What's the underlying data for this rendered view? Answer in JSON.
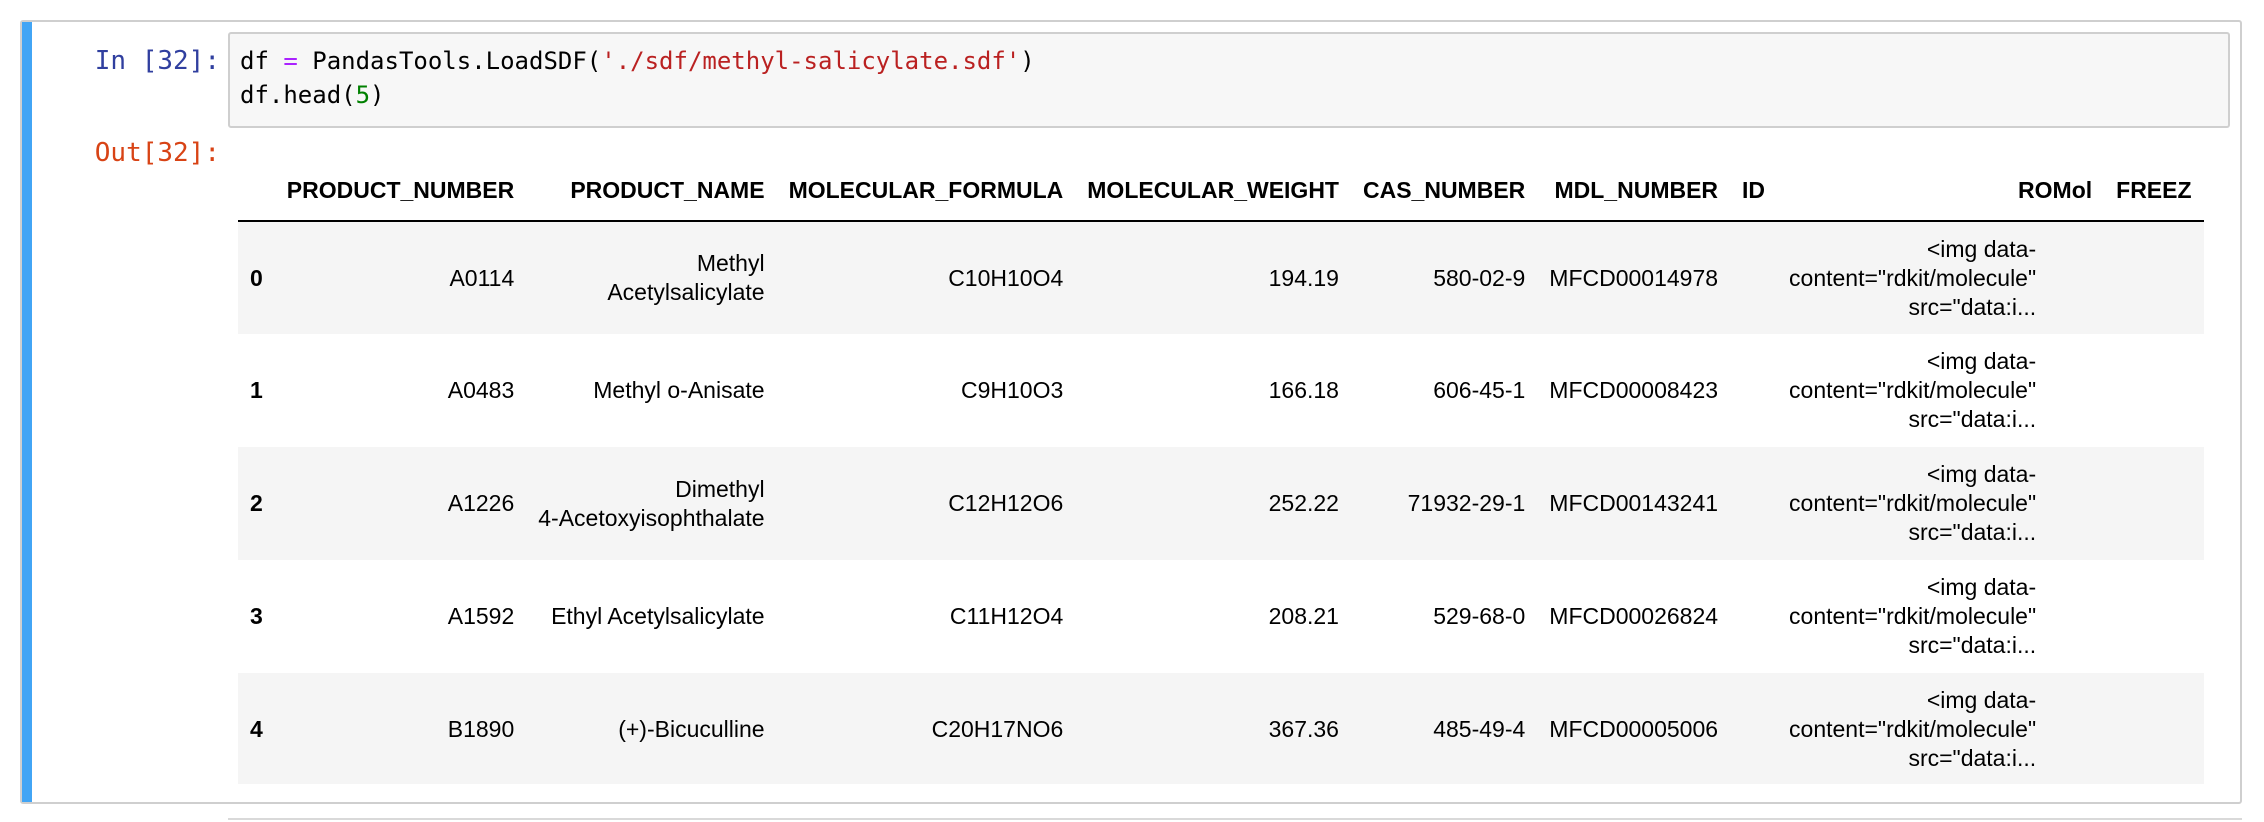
{
  "cell": {
    "in_prompt": "In [32]:",
    "out_prompt": "Out[32]:",
    "code": {
      "line1": [
        {
          "t": "df ",
          "c": ""
        },
        {
          "t": "=",
          "c": "op"
        },
        {
          "t": " PandasTools.LoadSDF(",
          "c": ""
        },
        {
          "t": "'./sdf/methyl-salicylate.sdf'",
          "c": "str"
        },
        {
          "t": ")",
          "c": ""
        }
      ],
      "line2": [
        {
          "t": "df.head(",
          "c": ""
        },
        {
          "t": "5",
          "c": "num"
        },
        {
          "t": ")",
          "c": ""
        }
      ]
    }
  },
  "table": {
    "columns": [
      "",
      "PRODUCT_NUMBER",
      "PRODUCT_NAME",
      "MOLECULAR_FORMULA",
      "MOLECULAR_WEIGHT",
      "CAS_NUMBER",
      "MDL_NUMBER",
      "ID",
      "ROMol",
      "FREEZ"
    ],
    "rows": [
      {
        "index": "0",
        "product_number": "A0114",
        "product_name": [
          "Methyl",
          "Acetylsalicylate"
        ],
        "formula": "C10H10O4",
        "weight": "194.19",
        "cas": "580-02-9",
        "mdl": "MFCD00014978",
        "id": "",
        "romol": [
          "<img data-",
          "content=\"rdkit/molecule\"",
          "src=\"data:i..."
        ]
      },
      {
        "index": "1",
        "product_number": "A0483",
        "product_name": [
          "Methyl o-Anisate"
        ],
        "formula": "C9H10O3",
        "weight": "166.18",
        "cas": "606-45-1",
        "mdl": "MFCD00008423",
        "id": "",
        "romol": [
          "<img data-",
          "content=\"rdkit/molecule\"",
          "src=\"data:i..."
        ]
      },
      {
        "index": "2",
        "product_number": "A1226",
        "product_name": [
          "Dimethyl",
          "4-Acetoxyisophthalate"
        ],
        "formula": "C12H12O6",
        "weight": "252.22",
        "cas": "71932-29-1",
        "mdl": "MFCD00143241",
        "id": "",
        "romol": [
          "<img data-",
          "content=\"rdkit/molecule\"",
          "src=\"data:i..."
        ]
      },
      {
        "index": "3",
        "product_number": "A1592",
        "product_name": [
          "Ethyl Acetylsalicylate"
        ],
        "formula": "C11H12O4",
        "weight": "208.21",
        "cas": "529-68-0",
        "mdl": "MFCD00026824",
        "id": "",
        "romol": [
          "<img data-",
          "content=\"rdkit/molecule\"",
          "src=\"data:i..."
        ]
      },
      {
        "index": "4",
        "product_number": "B1890",
        "product_name": [
          "(+)-Bicuculline"
        ],
        "formula": "C20H17NO6",
        "weight": "367.36",
        "cas": "485-49-4",
        "mdl": "MFCD00005006",
        "id": "",
        "romol": [
          "<img data-",
          "content=\"rdkit/molecule\"",
          "src=\"data:i..."
        ]
      }
    ]
  },
  "colors": {
    "cell_bar": "#42a5f5",
    "in_prompt": "#303f9f",
    "out_prompt": "#d84315",
    "code_bg": "#f7f7f7",
    "string": "#ba2121",
    "operator": "#aa22ff",
    "number": "#008000",
    "row_stripe": "#f5f5f5"
  }
}
